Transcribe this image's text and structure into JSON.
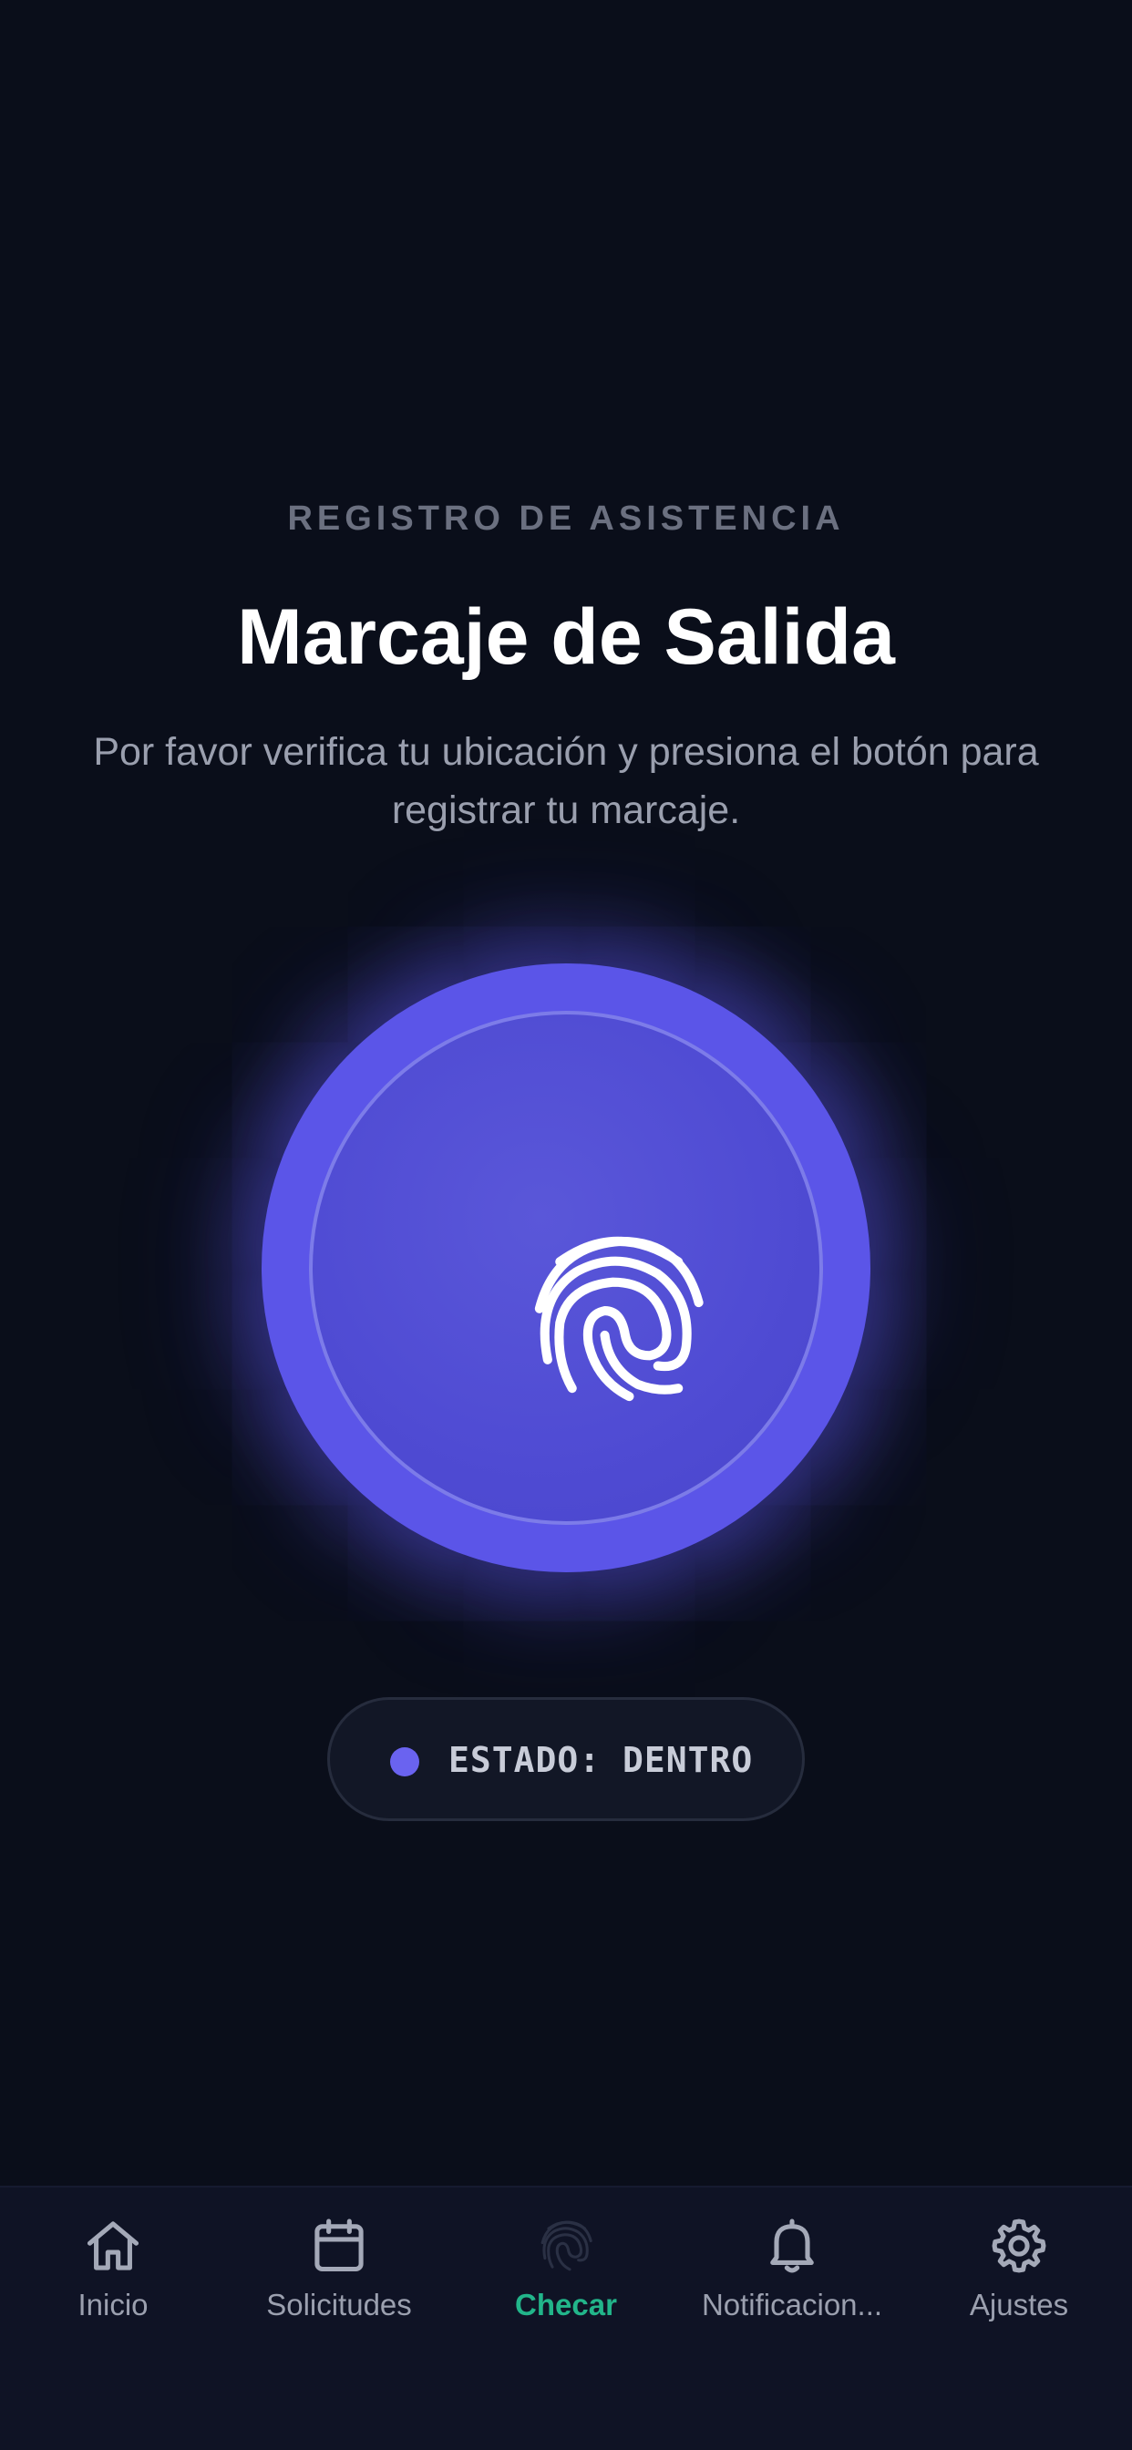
{
  "header": {
    "eyebrow": "REGISTRO DE ASISTENCIA",
    "title": "Marcaje de Salida",
    "subtitle": "Por favor verifica tu ubicación y presiona el botón para registrar tu marcaje."
  },
  "checkin_button": {
    "icon": "fingerprint-icon",
    "accent_color": "#5b55e8"
  },
  "status": {
    "label": "ESTADO: DENTRO",
    "dot_color": "#6a63f0"
  },
  "tabbar": {
    "active_color": "#22b58a",
    "tabs": [
      {
        "label": "Inicio",
        "icon": "home-icon"
      },
      {
        "label": "Solicitudes",
        "icon": "calendar-icon"
      },
      {
        "label": "Checar",
        "icon": "fingerprint-icon",
        "active": true
      },
      {
        "label": "Notificacion...",
        "icon": "bell-icon"
      },
      {
        "label": "Ajustes",
        "icon": "gear-icon"
      }
    ]
  }
}
